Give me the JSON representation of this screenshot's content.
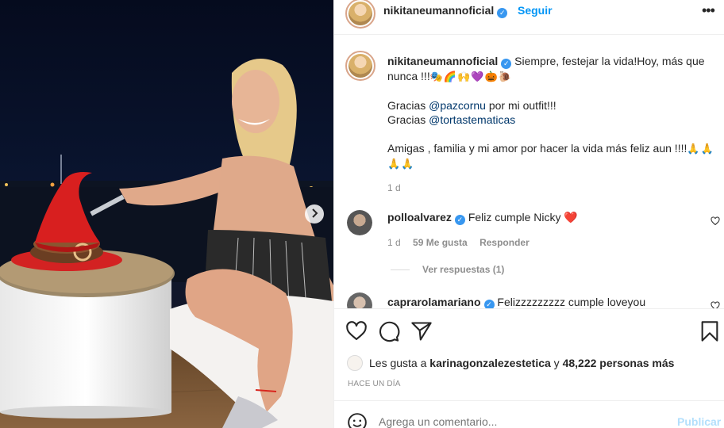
{
  "post": {
    "username": "nikitaneumannoficial",
    "follow_label": "Seguir",
    "more_label": "•••"
  },
  "caption": {
    "username": "nikitaneumannoficial",
    "line1": "Siempre, festejar la vida!Hoy, más que nunca !!!",
    "line1_emojis": "🎭🌈🙌💜🎃🐌",
    "thanks1_prefix": "Gracias ",
    "thanks1_mention": "@pazcornu",
    "thanks1_suffix": " por mi outfit!!!",
    "thanks2_prefix": "Gracias ",
    "thanks2_mention": "@tortastematicas",
    "line3": "Amigas , familia y mi amor por hacer la vida más feliz aun !!!!",
    "line3_emojis": "🙏🙏🙏🙏",
    "time": "1 d"
  },
  "comments": [
    {
      "username": "polloalvarez",
      "text": "Feliz cumple Nicky",
      "emoji": "❤️",
      "time": "1 d",
      "likes": "59 Me gusta",
      "reply_label": "Responder",
      "view_replies": "Ver respuestas (1)"
    },
    {
      "username": "caprarolamariano",
      "text": "Felizzzzzzzzz cumple loveyou"
    }
  ],
  "likes_line": {
    "prefix": "Les gusta a ",
    "user": "karinagonzalezestetica",
    "middle": " y ",
    "count": "48,222 personas más"
  },
  "timestamp": "HACE UN DÍA",
  "add_comment": {
    "placeholder": "Agrega un comentario...",
    "publish_label": "Publicar"
  },
  "icons": {
    "like": "heart-icon",
    "comment": "comment-icon",
    "share": "paper-plane-icon",
    "save": "bookmark-icon",
    "emoji": "smiley-icon",
    "next": "chevron-right-icon",
    "verified": "verified-badge-icon"
  },
  "colors": {
    "accent_blue": "#0095f6",
    "link_dark": "#00376b",
    "muted": "#8e8e8e",
    "publish_disabled": "#b2dffc"
  }
}
